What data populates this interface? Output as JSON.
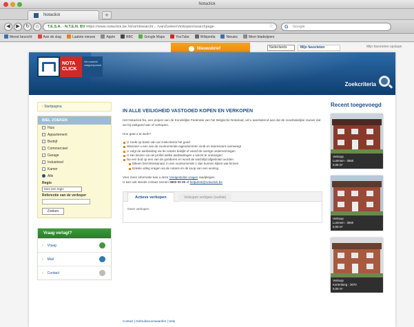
{
  "browser": {
    "window_title": "Notaclick",
    "tab_title": "Notaclick",
    "new_tab": "+",
    "url_host": "T.E.S.A. - N.T.E.N. BV",
    "url_rest": " https://www.notaclick.be /nl/ui/nl/search/... /vanZoekenVerkopen/searchpage",
    "search_placeholder": "Google",
    "search_logo": "G",
    "bookmarks": [
      {
        "label": "Meest bezocht",
        "color": "#3b6fb0"
      },
      {
        "label": "Aan de slag",
        "color": "#e0443e"
      },
      {
        "label": "Laatste nieuws",
        "color": "#e9820a"
      },
      {
        "label": "Apple",
        "color": "#888888"
      },
      {
        "label": "BBC",
        "color": "#444444"
      },
      {
        "label": "Google Maps",
        "color": "#4fb43a"
      },
      {
        "label": "YouTube",
        "color": "#cc2a2a"
      },
      {
        "label": "Wikipedia",
        "color": "#666666"
      },
      {
        "label": "Nieuws",
        "color": "#3b6fb0"
      },
      {
        "label": "Meer bladwijzers",
        "color": "#8a8a8a"
      }
    ]
  },
  "topbar": {
    "nieuwsbrief": "Nieuwsbrief",
    "lang_select": "Nederlands",
    "favorieten": "Mijn favorieten",
    "mijn_fav_link": "Mijn favorieten opslaan"
  },
  "banner": {
    "logo_line1": "NOTA",
    "logo_line2": "CLICK",
    "logo_sub": "Het notarieel vastgoedportaal",
    "zoekcriteria": "Zoekcriteria"
  },
  "left": {
    "home": "Startpagina",
    "search_heading": "BIEL ZOEKEN",
    "types": [
      "Huis",
      "Appartement",
      "Bedrijf",
      "Commercieel",
      "Garage",
      "Industrieel",
      "Kamer"
    ],
    "selected_type": "Alle",
    "regio_label": "Regio",
    "regio_value": "Kies een regio",
    "ref_label": "Referentie van de verkoper",
    "zoek_button": "Zoeken",
    "vraag_heading": "Vraag verlagt?",
    "vraag_items": [
      {
        "label": "Vraag",
        "color": "#3d9a3b"
      },
      {
        "label": "Mail",
        "color": "#2a7ab8"
      },
      {
        "label": "Contact",
        "color": "#bbbbbb"
      }
    ]
  },
  "main": {
    "title": "IN ALLE VEILIGHEID VASTGOED KOPEN EN VERKOPEN",
    "intro": "Het Notaclick-fra, een project van de Koninklijke Federatie van het Belgische Notariaat, wil u aansluitend aan dat de noodzakelijke manier dat we bij vastgoed aan of verkopen.",
    "how": "Hoe gaat u te werk?",
    "bullets": [
      "U zoekt op basis van uw zoekcriteria het goed",
      "Wanneer u een van de voorkomende eigendommen vindt en interessant overweegt",
      "U volgt de aanbieding via de notaris bekijkt of vanaf de overige ondernemingen",
      "U kan kiezen via uw profiel welke aanbiedingen u wenst te ontvangen",
      "Na een bod op een van de goederen en wordt de wachttijd afgesloten worden"
    ],
    "subbullets": [
      "Elkeen berichtenkanaal, in een voorkomende u dan kunnen kijken wat binnen",
      "Enkele uitleg vragen via de notaris en de koop van een woning"
    ],
    "help_text": "Voor meer informatie kan u deze",
    "help_link": "Veelgestelde vragen",
    "help_tail": "raadplegen.",
    "contact_prefix": "U kan ook steeds contact nemen",
    "contact_phone": "0800 00 00",
    "contact_mid": "of",
    "contact_mail": "helpdesk@notaclick.be",
    "tab_active": "Actieve verkopen",
    "tab_inactive": "Verkopen verlopen (oudste)",
    "tab_body": "Geen verkopen",
    "footer": "Contact | Gebruiksvoorwaarden | Help"
  },
  "right": {
    "heading": "Recent toegevoegd",
    "props": [
      {
        "line1": "Verkoop",
        "line2": "Lummen - 3560",
        "price": "0,00 m²",
        "wall": "#8a3a2a",
        "roof": "#4a2a22",
        "sky": "#c9d4dc"
      },
      {
        "line1": "Verkoop",
        "line2": "Lummen - 3560",
        "price": "0,00 m²",
        "wall": "#9a4a38",
        "roof": "#5a3a30",
        "sky": "#b8c8d8"
      },
      {
        "line1": "Verkoop",
        "line2": "Kortenberg - 3070",
        "price": "0,00 m²",
        "wall": "#a85a40",
        "roof": "#6a4030",
        "sky": "#d8dce0"
      }
    ]
  }
}
